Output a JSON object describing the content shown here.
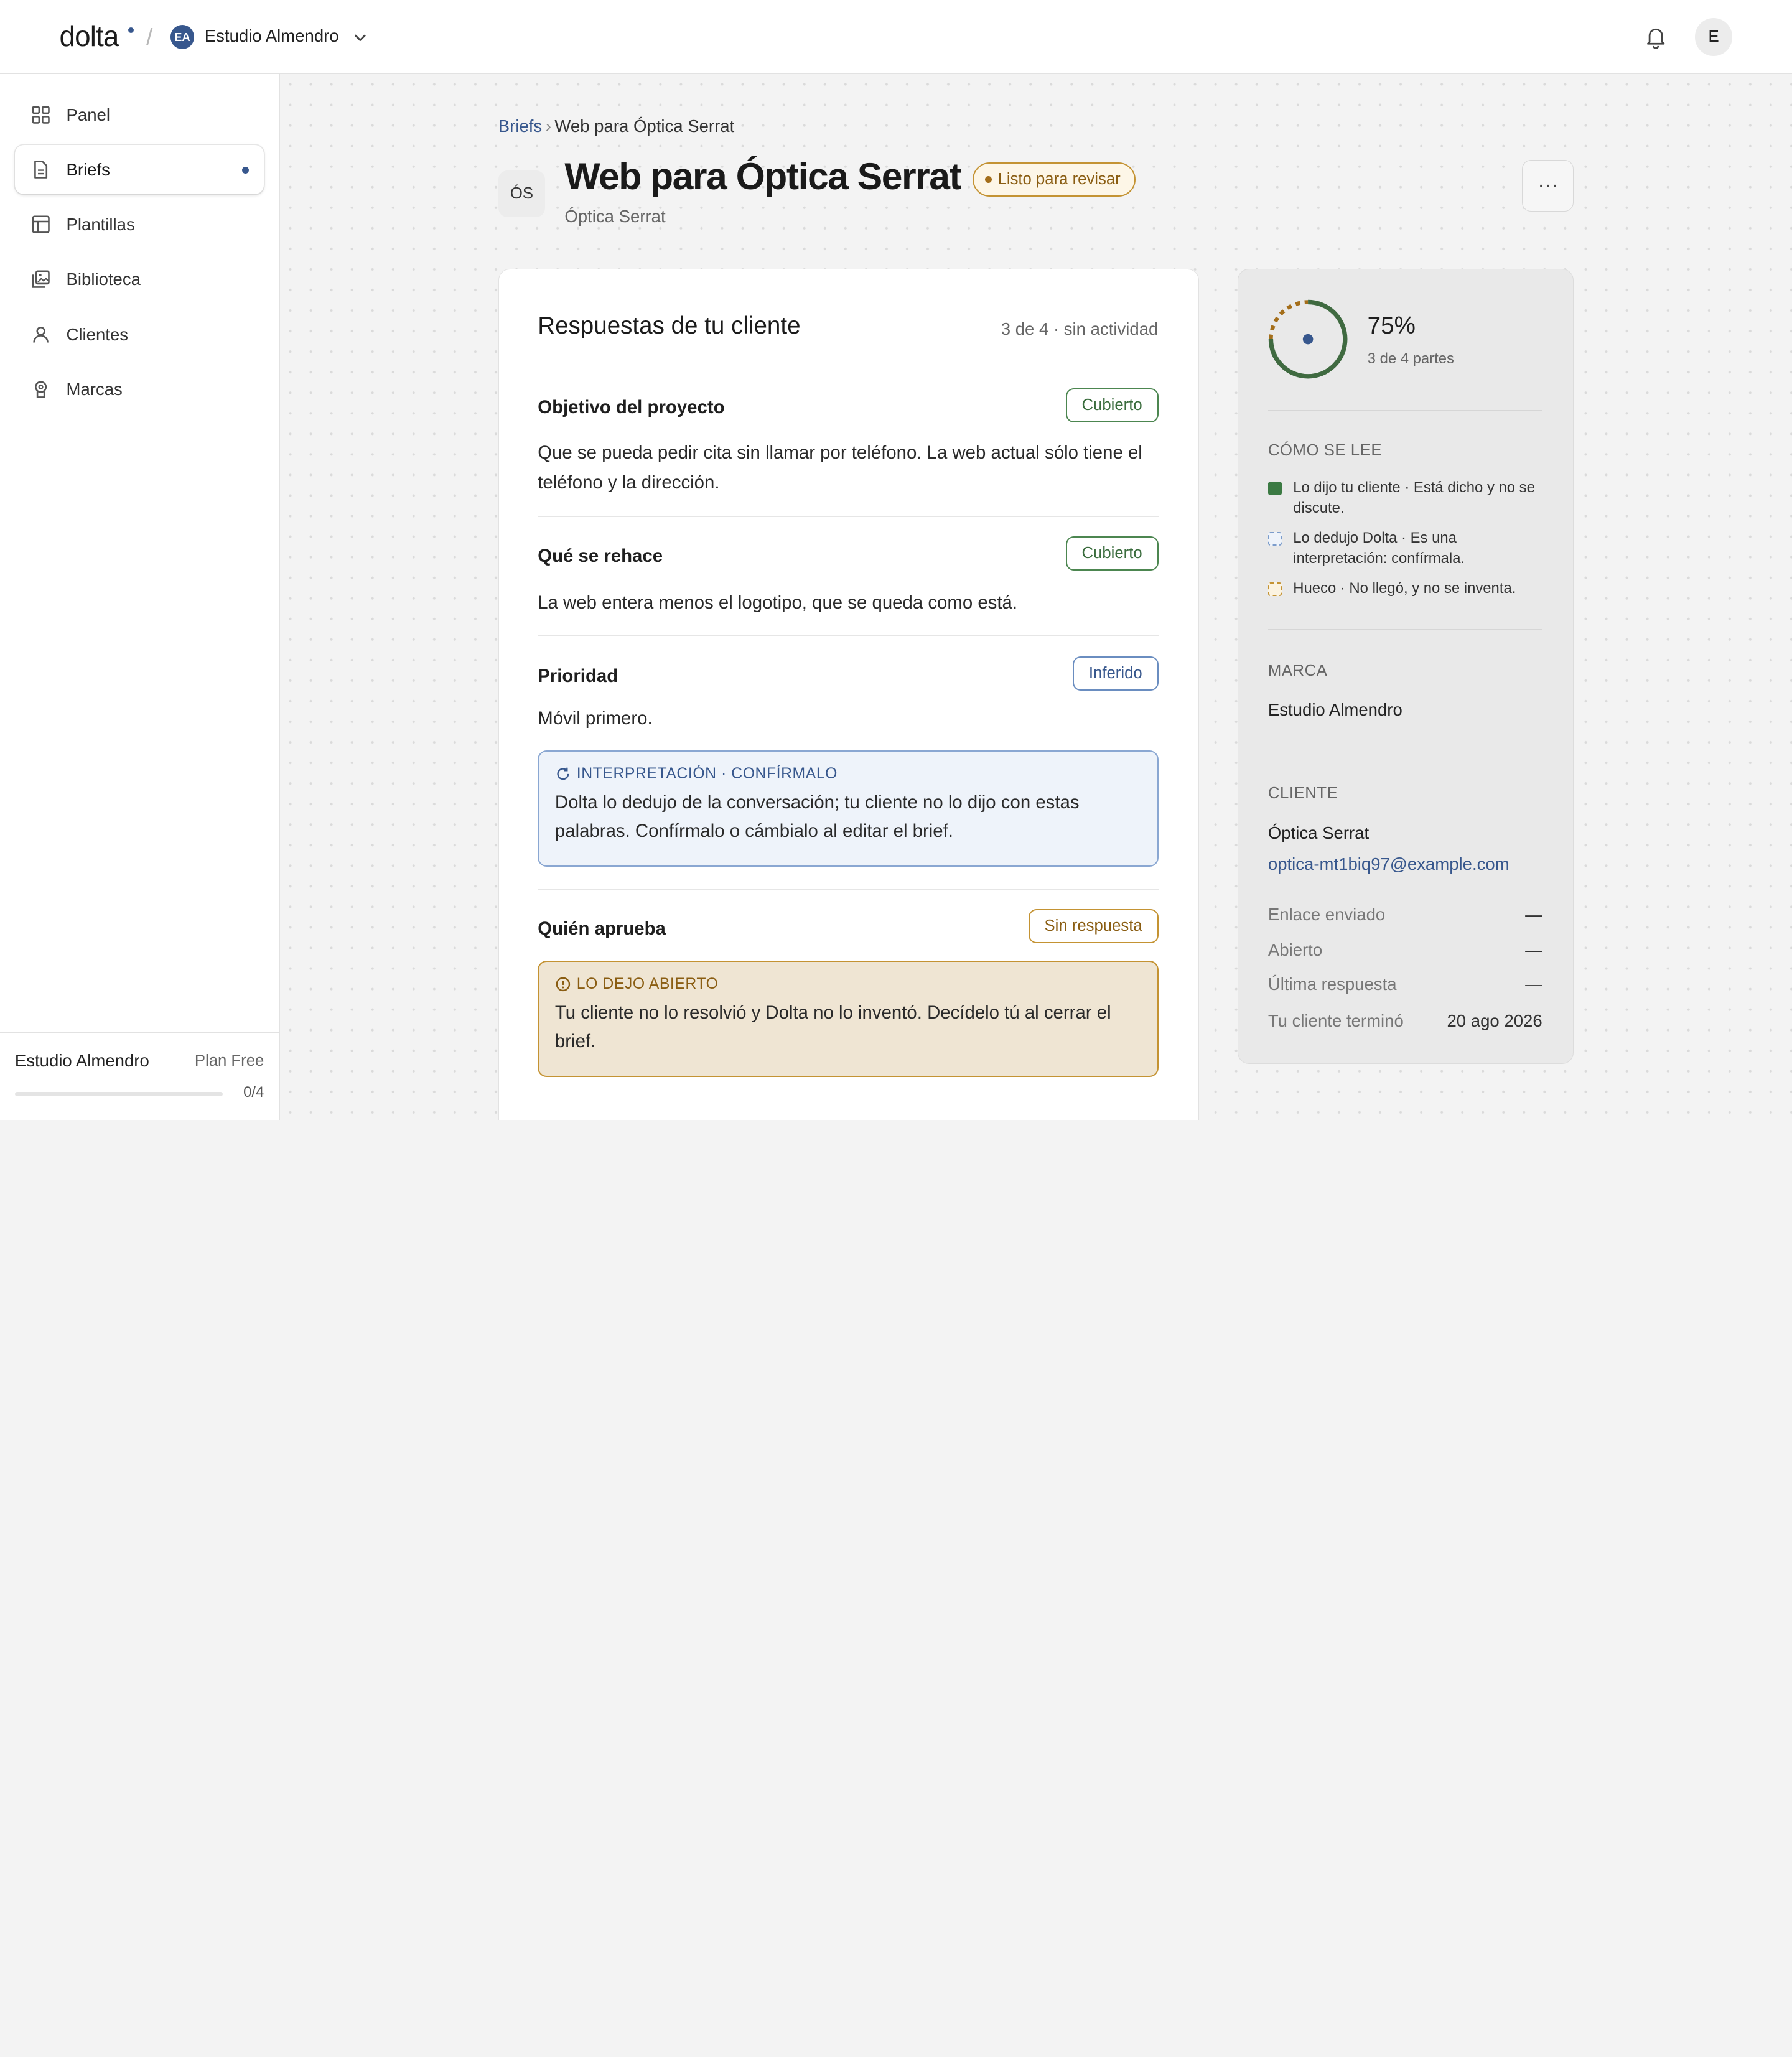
{
  "topbar": {
    "logo": "dolta",
    "workspace_initials": "EA",
    "workspace_name": "Estudio Almendro",
    "user_initial": "E",
    "accent": "#37578d"
  },
  "sidebar": {
    "items": [
      {
        "label": "Panel",
        "icon": "grid-icon"
      },
      {
        "label": "Briefs",
        "icon": "document-icon",
        "active": true,
        "has_dot": true
      },
      {
        "label": "Plantillas",
        "icon": "layout-icon"
      },
      {
        "label": "Biblioteca",
        "icon": "gallery-icon"
      },
      {
        "label": "Clientes",
        "icon": "person-icon"
      },
      {
        "label": "Marcas",
        "icon": "badge-icon"
      }
    ],
    "footer": {
      "workspace": "Estudio Almendro",
      "plan": "Plan Free",
      "usage_count": "0/4",
      "usage_fraction": 0
    }
  },
  "breadcrumb": {
    "parent": "Briefs",
    "separator": "›",
    "current": "Web para Óptica Serrat"
  },
  "header": {
    "tile": "ÓS",
    "title": "Web para Óptica Serrat",
    "status": "Listo para revisar",
    "subtitle": "Óptica Serrat",
    "more": "···"
  },
  "answers": {
    "title": "Respuestas de tu cliente",
    "meta": "3 de 4 · sin actividad",
    "questions": [
      {
        "title": "Objetivo del proyecto",
        "badge": "Cubierto",
        "answer": "Que se pueda pedir cita sin llamar por teléfono. La web actual sólo tiene el teléfono y la dirección."
      },
      {
        "title": "Qué se rehace",
        "badge": "Cubierto",
        "answer": "La web entera menos el logotipo, que se queda como está."
      },
      {
        "title": "Prioridad",
        "badge": "Inferido",
        "answer": "Móvil primero.",
        "note_head": "INTERPRETACIÓN · CONFÍRMALO",
        "note_body": "Dolta lo dedujo de la conversación; tu cliente no lo dijo con estas palabras. Confírmalo o cámbialo al editar el brief."
      },
      {
        "title": "Quién aprueba",
        "badge": "Sin respuesta",
        "note_head": "LO DEJO ABIERTO",
        "note_body": "Tu cliente no lo resolvió y Dolta no lo inventó. Decídelo tú al cerrar el brief."
      }
    ]
  },
  "panel": {
    "progress_pct": "75%",
    "progress_fraction": 0.75,
    "progress_sub": "3 de 4 partes",
    "legend_head": "CÓMO SE LEE",
    "legend": [
      {
        "text": "Lo dijo tu cliente · Está dicho y no se discute."
      },
      {
        "text": "Lo dedujo Dolta · Es una interpretación: confírmala."
      },
      {
        "text": "Hueco · No llegó, y no se inventa."
      }
    ],
    "brand_head": "MARCA",
    "brand": "Estudio Almendro",
    "client_head": "CLIENTE",
    "client_name": "Óptica Serrat",
    "client_email": "optica-mt1biq97@example.com",
    "timeline": [
      {
        "label": "Enlace enviado",
        "value": "—"
      },
      {
        "label": "Abierto",
        "value": "—"
      },
      {
        "label": "Última respuesta",
        "value": "—"
      },
      {
        "label": "Tu cliente terminó",
        "value": "20 ago 2026"
      }
    ]
  }
}
